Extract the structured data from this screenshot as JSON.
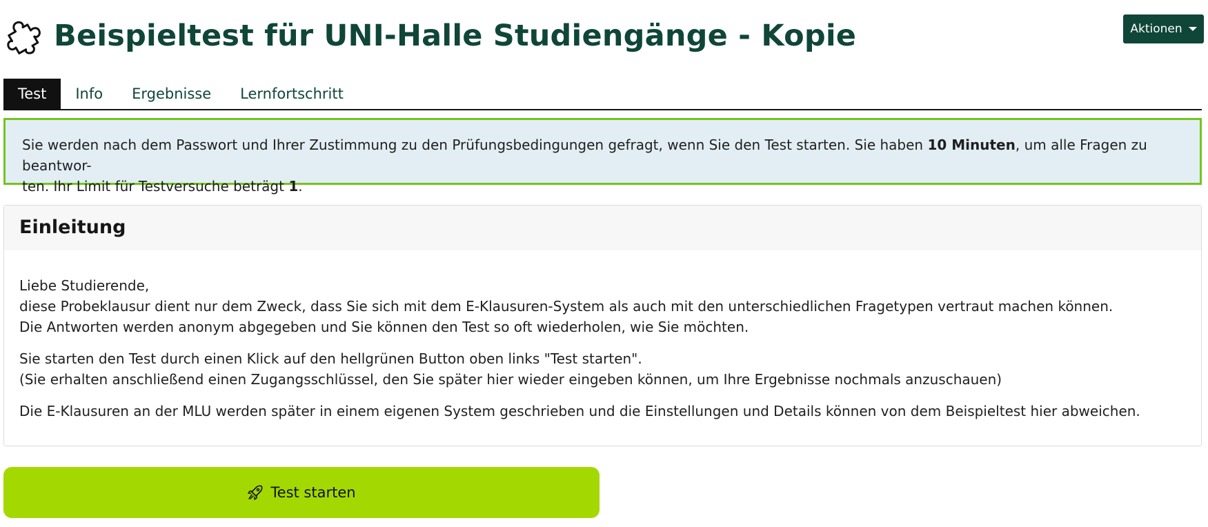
{
  "header": {
    "title": "Beispieltest für UNI-Halle Studiengänge - Kopie",
    "icon": "puzzle-icon",
    "actions_label": "Aktionen"
  },
  "tabs": [
    {
      "label": "Test",
      "active": true
    },
    {
      "label": "Info",
      "active": false
    },
    {
      "label": "Ergebnisse",
      "active": false
    },
    {
      "label": "Lernfortschritt",
      "active": false
    }
  ],
  "info": {
    "text_1": "Sie werden nach dem Passwort und Ihrer Zustimmung zu den Prüfungsbedingungen gefragt, wenn Sie den Test starten. Sie haben ",
    "duration": "10 Minuten",
    "text_2": ", um alle Fragen zu beantwor-",
    "text_3": "ten. Ihr Limit für Testversuche beträgt ",
    "attempts": "1",
    "text_4": "."
  },
  "intro": {
    "heading": "Einleitung",
    "lines": [
      "Liebe Studierende,",
      "diese Probeklausur dient nur dem Zweck, dass Sie sich mit dem E-Klausuren-System als auch mit den unterschiedlichen Fragetypen vertraut machen können.",
      "Die Antworten werden anonym abgegeben und Sie können den Test so oft wiederholen, wie Sie möchten.",
      "Sie starten den Test durch einen Klick auf den hellgrünen Button oben links \"Test starten\".",
      "(Sie erhalten anschließend einen Zugangsschlüssel, den Sie später hier wieder eingeben können, um Ihre Ergebnisse nochmals anzuschauen)",
      "Die E-Klausuren an der MLU werden später in einem eigenen System geschrieben und die Einstellungen und Details können von dem Beispieltest hier abweichen."
    ]
  },
  "start_button": {
    "label": "Test starten",
    "icon": "rocket-icon"
  },
  "colors": {
    "brand_dark_green": "#0f4637",
    "info_border": "#73c51e",
    "info_bg": "#e2eef4",
    "start_button_bg": "#a3d900"
  }
}
